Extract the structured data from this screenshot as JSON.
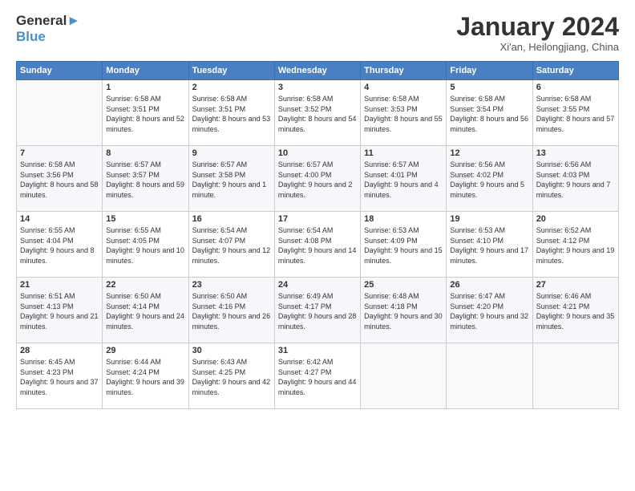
{
  "header": {
    "logo_line1": "General",
    "logo_line2": "Blue",
    "month_title": "January 2024",
    "subtitle": "Xi'an, Heilongjiang, China"
  },
  "days_of_week": [
    "Sunday",
    "Monday",
    "Tuesday",
    "Wednesday",
    "Thursday",
    "Friday",
    "Saturday"
  ],
  "weeks": [
    [
      {
        "day": "",
        "sunrise": "",
        "sunset": "",
        "daylight": ""
      },
      {
        "day": "1",
        "sunrise": "Sunrise: 6:58 AM",
        "sunset": "Sunset: 3:51 PM",
        "daylight": "Daylight: 8 hours and 52 minutes."
      },
      {
        "day": "2",
        "sunrise": "Sunrise: 6:58 AM",
        "sunset": "Sunset: 3:51 PM",
        "daylight": "Daylight: 8 hours and 53 minutes."
      },
      {
        "day": "3",
        "sunrise": "Sunrise: 6:58 AM",
        "sunset": "Sunset: 3:52 PM",
        "daylight": "Daylight: 8 hours and 54 minutes."
      },
      {
        "day": "4",
        "sunrise": "Sunrise: 6:58 AM",
        "sunset": "Sunset: 3:53 PM",
        "daylight": "Daylight: 8 hours and 55 minutes."
      },
      {
        "day": "5",
        "sunrise": "Sunrise: 6:58 AM",
        "sunset": "Sunset: 3:54 PM",
        "daylight": "Daylight: 8 hours and 56 minutes."
      },
      {
        "day": "6",
        "sunrise": "Sunrise: 6:58 AM",
        "sunset": "Sunset: 3:55 PM",
        "daylight": "Daylight: 8 hours and 57 minutes."
      }
    ],
    [
      {
        "day": "7",
        "sunrise": "Sunrise: 6:58 AM",
        "sunset": "Sunset: 3:56 PM",
        "daylight": "Daylight: 8 hours and 58 minutes."
      },
      {
        "day": "8",
        "sunrise": "Sunrise: 6:57 AM",
        "sunset": "Sunset: 3:57 PM",
        "daylight": "Daylight: 8 hours and 59 minutes."
      },
      {
        "day": "9",
        "sunrise": "Sunrise: 6:57 AM",
        "sunset": "Sunset: 3:58 PM",
        "daylight": "Daylight: 9 hours and 1 minute."
      },
      {
        "day": "10",
        "sunrise": "Sunrise: 6:57 AM",
        "sunset": "Sunset: 4:00 PM",
        "daylight": "Daylight: 9 hours and 2 minutes."
      },
      {
        "day": "11",
        "sunrise": "Sunrise: 6:57 AM",
        "sunset": "Sunset: 4:01 PM",
        "daylight": "Daylight: 9 hours and 4 minutes."
      },
      {
        "day": "12",
        "sunrise": "Sunrise: 6:56 AM",
        "sunset": "Sunset: 4:02 PM",
        "daylight": "Daylight: 9 hours and 5 minutes."
      },
      {
        "day": "13",
        "sunrise": "Sunrise: 6:56 AM",
        "sunset": "Sunset: 4:03 PM",
        "daylight": "Daylight: 9 hours and 7 minutes."
      }
    ],
    [
      {
        "day": "14",
        "sunrise": "Sunrise: 6:55 AM",
        "sunset": "Sunset: 4:04 PM",
        "daylight": "Daylight: 9 hours and 8 minutes."
      },
      {
        "day": "15",
        "sunrise": "Sunrise: 6:55 AM",
        "sunset": "Sunset: 4:05 PM",
        "daylight": "Daylight: 9 hours and 10 minutes."
      },
      {
        "day": "16",
        "sunrise": "Sunrise: 6:54 AM",
        "sunset": "Sunset: 4:07 PM",
        "daylight": "Daylight: 9 hours and 12 minutes."
      },
      {
        "day": "17",
        "sunrise": "Sunrise: 6:54 AM",
        "sunset": "Sunset: 4:08 PM",
        "daylight": "Daylight: 9 hours and 14 minutes."
      },
      {
        "day": "18",
        "sunrise": "Sunrise: 6:53 AM",
        "sunset": "Sunset: 4:09 PM",
        "daylight": "Daylight: 9 hours and 15 minutes."
      },
      {
        "day": "19",
        "sunrise": "Sunrise: 6:53 AM",
        "sunset": "Sunset: 4:10 PM",
        "daylight": "Daylight: 9 hours and 17 minutes."
      },
      {
        "day": "20",
        "sunrise": "Sunrise: 6:52 AM",
        "sunset": "Sunset: 4:12 PM",
        "daylight": "Daylight: 9 hours and 19 minutes."
      }
    ],
    [
      {
        "day": "21",
        "sunrise": "Sunrise: 6:51 AM",
        "sunset": "Sunset: 4:13 PM",
        "daylight": "Daylight: 9 hours and 21 minutes."
      },
      {
        "day": "22",
        "sunrise": "Sunrise: 6:50 AM",
        "sunset": "Sunset: 4:14 PM",
        "daylight": "Daylight: 9 hours and 24 minutes."
      },
      {
        "day": "23",
        "sunrise": "Sunrise: 6:50 AM",
        "sunset": "Sunset: 4:16 PM",
        "daylight": "Daylight: 9 hours and 26 minutes."
      },
      {
        "day": "24",
        "sunrise": "Sunrise: 6:49 AM",
        "sunset": "Sunset: 4:17 PM",
        "daylight": "Daylight: 9 hours and 28 minutes."
      },
      {
        "day": "25",
        "sunrise": "Sunrise: 6:48 AM",
        "sunset": "Sunset: 4:18 PM",
        "daylight": "Daylight: 9 hours and 30 minutes."
      },
      {
        "day": "26",
        "sunrise": "Sunrise: 6:47 AM",
        "sunset": "Sunset: 4:20 PM",
        "daylight": "Daylight: 9 hours and 32 minutes."
      },
      {
        "day": "27",
        "sunrise": "Sunrise: 6:46 AM",
        "sunset": "Sunset: 4:21 PM",
        "daylight": "Daylight: 9 hours and 35 minutes."
      }
    ],
    [
      {
        "day": "28",
        "sunrise": "Sunrise: 6:45 AM",
        "sunset": "Sunset: 4:23 PM",
        "daylight": "Daylight: 9 hours and 37 minutes."
      },
      {
        "day": "29",
        "sunrise": "Sunrise: 6:44 AM",
        "sunset": "Sunset: 4:24 PM",
        "daylight": "Daylight: 9 hours and 39 minutes."
      },
      {
        "day": "30",
        "sunrise": "Sunrise: 6:43 AM",
        "sunset": "Sunset: 4:25 PM",
        "daylight": "Daylight: 9 hours and 42 minutes."
      },
      {
        "day": "31",
        "sunrise": "Sunrise: 6:42 AM",
        "sunset": "Sunset: 4:27 PM",
        "daylight": "Daylight: 9 hours and 44 minutes."
      },
      {
        "day": "",
        "sunrise": "",
        "sunset": "",
        "daylight": ""
      },
      {
        "day": "",
        "sunrise": "",
        "sunset": "",
        "daylight": ""
      },
      {
        "day": "",
        "sunrise": "",
        "sunset": "",
        "daylight": ""
      }
    ]
  ]
}
